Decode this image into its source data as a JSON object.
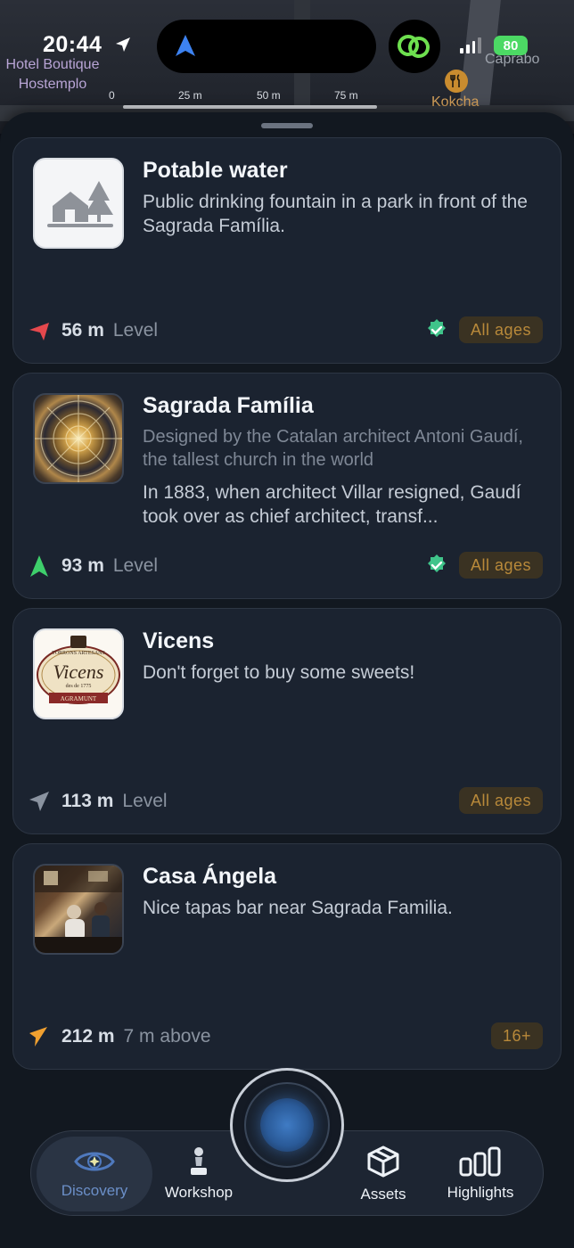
{
  "status": {
    "time": "20:44",
    "battery": "80"
  },
  "map": {
    "labels": {
      "hotel": "Hotel Boutique Hostemplo",
      "caprabo": "Caprabo",
      "kokcha": "Kokcha"
    },
    "scale": [
      "0",
      "25 m",
      "50 m",
      "75 m"
    ]
  },
  "cards": [
    {
      "title": "Potable water",
      "description": "Public drinking fountain in a park in front of the Sagrada Família.",
      "distance": "56 m",
      "level": "Level",
      "verified": true,
      "age": "All ages",
      "arrow_color": "#e5484d"
    },
    {
      "title": "Sagrada Família",
      "subtitle": "Designed by the Catalan architect Antoni Gaudí, the tallest church in the world",
      "description": "In 1883, when architect Villar resigned, Gaudí took over as chief architect, transf...",
      "distance": "93 m",
      "level": "Level",
      "verified": true,
      "age": "All ages",
      "arrow_color": "#3ecf6b"
    },
    {
      "title": "Vicens",
      "description": "Don't forget to buy some sweets!",
      "distance": "113 m",
      "level": "Level",
      "verified": false,
      "age": "All ages",
      "arrow_color": "#8a93a0",
      "logo": {
        "top": "TORRONS ARTESANS",
        "name": "Vicens",
        "since": "des de 1775",
        "bottom": "AGRAMUNT"
      }
    },
    {
      "title": "Casa Ángela",
      "description": "Nice tapas bar near Sagrada Familia.",
      "distance": "212 m",
      "level": "7 m above",
      "verified": false,
      "age": "16+",
      "arrow_color": "#f0a030"
    }
  ],
  "tabs": {
    "discovery": "Discovery",
    "workshop": "Workshop",
    "assets": "Assets",
    "highlights": "Highlights"
  }
}
